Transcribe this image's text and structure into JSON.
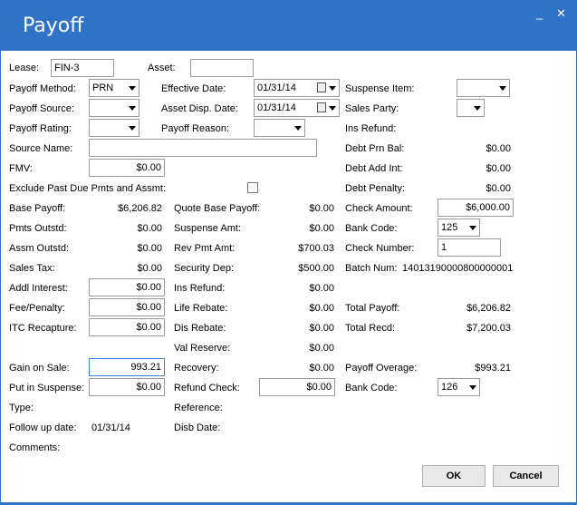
{
  "window": {
    "title": "Payoff",
    "minimize": "_",
    "close": "✕"
  },
  "fields": {
    "lease": {
      "label": "Lease:",
      "value": "FIN-3"
    },
    "asset": {
      "label": "Asset:",
      "value": ""
    },
    "payoff_method": {
      "label": "Payoff Method:",
      "value": "PRN"
    },
    "effective_date": {
      "label": "Effective Date:",
      "value": "01/31/14"
    },
    "suspense_item": {
      "label": "Suspense Item:",
      "value": ""
    },
    "payoff_source": {
      "label": "Payoff Source:",
      "value": ""
    },
    "asset_disp_date": {
      "label": "Asset Disp. Date:",
      "value": "01/31/14"
    },
    "sales_party": {
      "label": "Sales Party:",
      "value": ""
    },
    "payoff_rating": {
      "label": "Payoff Rating:",
      "value": ""
    },
    "payoff_reason": {
      "label": "Payoff Reason:",
      "value": ""
    },
    "ins_refund_top": {
      "label": "Ins Refund:"
    },
    "source_name": {
      "label": "Source Name:",
      "value": ""
    },
    "debt_prn_bal": {
      "label": "Debt Prn Bal:",
      "value": "$0.00"
    },
    "fmv": {
      "label": "FMV:",
      "value": "$0.00"
    },
    "debt_add_int": {
      "label": "Debt Add Int:",
      "value": "$0.00"
    },
    "exclude_past_due": {
      "label": "Exclude Past Due Pmts and Assmt:",
      "checked": false
    },
    "debt_penalty": {
      "label": "Debt Penalty:",
      "value": "$0.00"
    },
    "base_payoff": {
      "label": "Base Payoff:",
      "value": "$6,206.82"
    },
    "quote_base_payoff": {
      "label": "Quote Base Payoff:",
      "value": "$0.00"
    },
    "check_amount": {
      "label": "Check Amount:",
      "value": "$6,000.00"
    },
    "pmts_outstd": {
      "label": "Pmts Outstd:",
      "value": "$0.00"
    },
    "suspense_amt": {
      "label": "Suspense Amt:",
      "value": "$0.00"
    },
    "bank_code_1": {
      "label": "Bank Code:",
      "value": "125"
    },
    "assm_outstd": {
      "label": "Assm Outstd:",
      "value": "$0.00"
    },
    "rev_pmt_amt": {
      "label": "Rev Pmt Amt:",
      "value": "$700.03"
    },
    "check_number": {
      "label": "Check Number:",
      "value": "1"
    },
    "sales_tax": {
      "label": "Sales Tax:",
      "value": "$0.00"
    },
    "security_dep": {
      "label": "Security Dep:",
      "value": "$500.00"
    },
    "batch_num": {
      "label": "Batch Num:",
      "value": "14013190000800000001"
    },
    "addl_interest": {
      "label": "Addl Interest:",
      "value": "$0.00"
    },
    "ins_refund": {
      "label": "Ins Refund:",
      "value": "$0.00"
    },
    "fee_penalty": {
      "label": "Fee/Penalty:",
      "value": "$0.00"
    },
    "life_rebate": {
      "label": "Life Rebate:",
      "value": "$0.00"
    },
    "total_payoff": {
      "label": "Total Payoff:",
      "value": "$6,206.82"
    },
    "itc_recapture": {
      "label": "ITC Recapture:",
      "value": "$0.00"
    },
    "dis_rebate": {
      "label": "Dis Rebate:",
      "value": "$0.00"
    },
    "total_recd": {
      "label": "Total Recd:",
      "value": "$7,200.03"
    },
    "val_reserve": {
      "label": "Val Reserve:",
      "value": "$0.00"
    },
    "gain_on_sale": {
      "label": "Gain on Sale:",
      "value": "993.21"
    },
    "recovery": {
      "label": "Recovery:",
      "value": "$0.00"
    },
    "payoff_overage": {
      "label": "Payoff Overage:",
      "value": "$993.21"
    },
    "put_in_suspense": {
      "label": "Put in Suspense:",
      "value": "$0.00"
    },
    "refund_check": {
      "label": "Refund Check:",
      "value": "$0.00"
    },
    "bank_code_2": {
      "label": "Bank Code:",
      "value": "126"
    },
    "type": {
      "label": "Type:"
    },
    "reference": {
      "label": "Reference:"
    },
    "follow_up_date": {
      "label": "Follow up date:",
      "value": "01/31/14"
    },
    "disb_date": {
      "label": "Disb Date:"
    },
    "comments": {
      "label": "Comments:"
    }
  },
  "buttons": {
    "ok": "OK",
    "cancel": "Cancel"
  },
  "colors": {
    "titlebar": "#2f73c9"
  }
}
